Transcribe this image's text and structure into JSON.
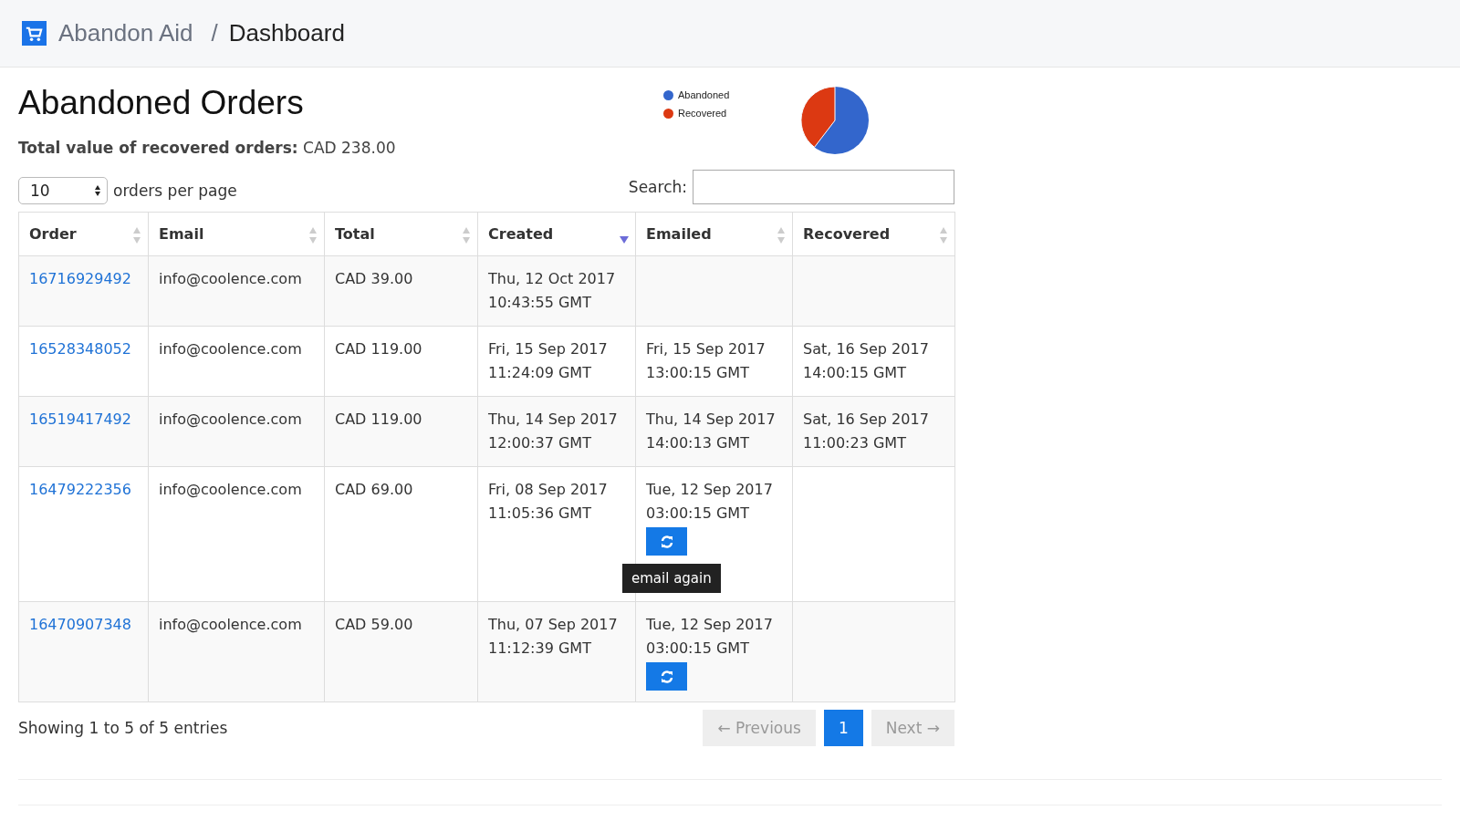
{
  "header": {
    "brand": "Abandon Aid",
    "separator": "/",
    "page": "Dashboard"
  },
  "title": "Abandoned Orders",
  "summary": "**Total value of recovered orders:** CAD 238.00",
  "legend": [
    {
      "label": "Abandoned",
      "color": "#3366cc"
    },
    {
      "label": "Recovered",
      "color": "#dc3912"
    }
  ],
  "length": {
    "value": "10",
    "label": "orders per page"
  },
  "search": {
    "label": "Search:"
  },
  "columns": [
    {
      "label": "Order",
      "sorted": false
    },
    {
      "label": "Email",
      "sorted": false
    },
    {
      "label": "Total",
      "sorted": false
    },
    {
      "label": "Created",
      "sorted": true
    },
    {
      "label": "Emailed",
      "sorted": false
    },
    {
      "label": "Recovered",
      "sorted": false
    }
  ],
  "rows": [
    {
      "order": "16716929492",
      "email": "info@coolence.com",
      "total": "CAD 39.00",
      "created": [
        "Thu, 12 Oct 2017",
        "10:43:55 GMT"
      ],
      "emailed": [],
      "resend": false,
      "recovered": []
    },
    {
      "order": "16528348052",
      "email": "info@coolence.com",
      "total": "CAD 119.00",
      "created": [
        "Fri, 15 Sep 2017",
        "11:24:09 GMT"
      ],
      "emailed": [
        "Fri, 15 Sep 2017",
        "13:00:15 GMT"
      ],
      "resend": false,
      "recovered": [
        "Sat, 16 Sep 2017",
        "14:00:15 GMT"
      ]
    },
    {
      "order": "16519417492",
      "email": "info@coolence.com",
      "total": "CAD 119.00",
      "created": [
        "Thu, 14 Sep 2017",
        "12:00:37 GMT"
      ],
      "emailed": [
        "Thu, 14 Sep 2017",
        "14:00:13 GMT"
      ],
      "resend": false,
      "recovered": [
        "Sat, 16 Sep 2017",
        "11:00:23 GMT"
      ]
    },
    {
      "order": "16479222356",
      "email": "info@coolence.com",
      "total": "CAD 69.00",
      "created": [
        "Fri, 08 Sep 2017",
        "11:05:36 GMT"
      ],
      "emailed": [
        "Tue, 12 Sep 2017",
        "03:00:15 GMT"
      ],
      "resend": true,
      "tooltip": "email again",
      "recovered": []
    },
    {
      "order": "16470907348",
      "email": "info@coolence.com",
      "total": "CAD 59.00",
      "created": [
        "Thu, 07 Sep 2017",
        "11:12:39 GMT"
      ],
      "emailed": [
        "Tue, 12 Sep 2017",
        "03:00:15 GMT"
      ],
      "resend": true,
      "recovered": []
    }
  ],
  "info": "Showing 1 to 5 of 5 entries",
  "pages": [
    {
      "label": "← Previous",
      "selected": false,
      "disabled": true
    },
    {
      "label": "1",
      "selected": true,
      "disabled": false
    },
    {
      "label": "Next →",
      "selected": false,
      "disabled": true
    }
  ]
}
